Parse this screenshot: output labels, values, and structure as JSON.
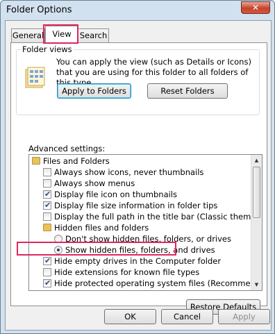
{
  "window": {
    "title": "Folder Options",
    "close_label": "✕"
  },
  "tabs": [
    {
      "label": "General"
    },
    {
      "label": "View"
    },
    {
      "label": "Search"
    }
  ],
  "folder_views": {
    "title": "Folder views",
    "description": "You can apply the view (such as Details or Icons) that you are using for this folder to all folders of this type.",
    "apply_button": "Apply to Folders",
    "reset_button": "Reset Folders"
  },
  "advanced": {
    "label": "Advanced settings:",
    "items": [
      {
        "label": "Files and Folders",
        "kind": "folder"
      },
      {
        "label": "Always show icons, never thumbnails",
        "kind": "checkbox",
        "checked": false
      },
      {
        "label": "Always show menus",
        "kind": "checkbox",
        "checked": false
      },
      {
        "label": "Display file icon on thumbnails",
        "kind": "checkbox",
        "checked": true
      },
      {
        "label": "Display file size information in folder tips",
        "kind": "checkbox",
        "checked": true
      },
      {
        "label": "Display the full path in the title bar (Classic theme only)",
        "kind": "checkbox",
        "checked": false
      },
      {
        "label": "Hidden files and folders",
        "kind": "folder"
      },
      {
        "label": "Don't show hidden files, folders, or drives",
        "kind": "radio",
        "selected": false
      },
      {
        "label": "Show hidden files, folders, and drives",
        "kind": "radio",
        "selected": true
      },
      {
        "label": "Hide empty drives in the Computer folder",
        "kind": "checkbox",
        "checked": true
      },
      {
        "label": "Hide extensions for known file types",
        "kind": "checkbox",
        "checked": false
      },
      {
        "label": "Hide protected operating system files (Recommended)",
        "kind": "checkbox",
        "checked": true
      }
    ],
    "scroll": {
      "up_icon": "▲",
      "down_icon": "▼"
    }
  },
  "buttons": {
    "restore_defaults": "Restore Defaults",
    "ok": "OK",
    "cancel": "Cancel",
    "apply": "Apply"
  },
  "colors": {
    "highlight": "#e0265e"
  }
}
